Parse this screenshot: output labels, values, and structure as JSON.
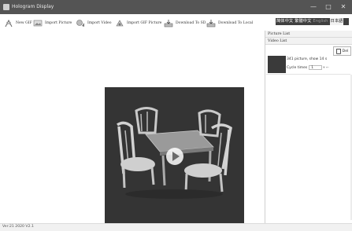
{
  "window": {
    "title": "Hologram Display",
    "minimize_glyph": "—",
    "maximize_glyph": "□",
    "close_glyph": "✕"
  },
  "toolbar": {
    "items": [
      {
        "label": "New GIF",
        "icon": "new-gif-icon"
      },
      {
        "label": "Import Picture",
        "icon": "import-picture-icon"
      },
      {
        "label": "Import Video",
        "icon": "import-video-icon"
      },
      {
        "label": "Import GIF Picture",
        "icon": "import-gif-icon"
      },
      {
        "label": "Download To SD",
        "icon": "download-sd-icon"
      },
      {
        "label": "Download To Local",
        "icon": "download-local-icon"
      }
    ]
  },
  "languages": {
    "simplified_chinese": "简体中文",
    "traditional_chinese": "繁體中文",
    "english": "English",
    "japanese": "日本語"
  },
  "side_panel": {
    "picture_list": "Picture List",
    "video_list": "Video List",
    "del_label": "Del",
    "item": {
      "info": "341 picture, show 14 s",
      "cycle_label": "Cycle times",
      "cycle_value": "1"
    }
  },
  "status": {
    "version": "Ver:21 2020 V2.1"
  },
  "colors": {
    "titlebar": "#545454",
    "video_bg": "#343434",
    "lang_box": "#3f3f3f"
  }
}
